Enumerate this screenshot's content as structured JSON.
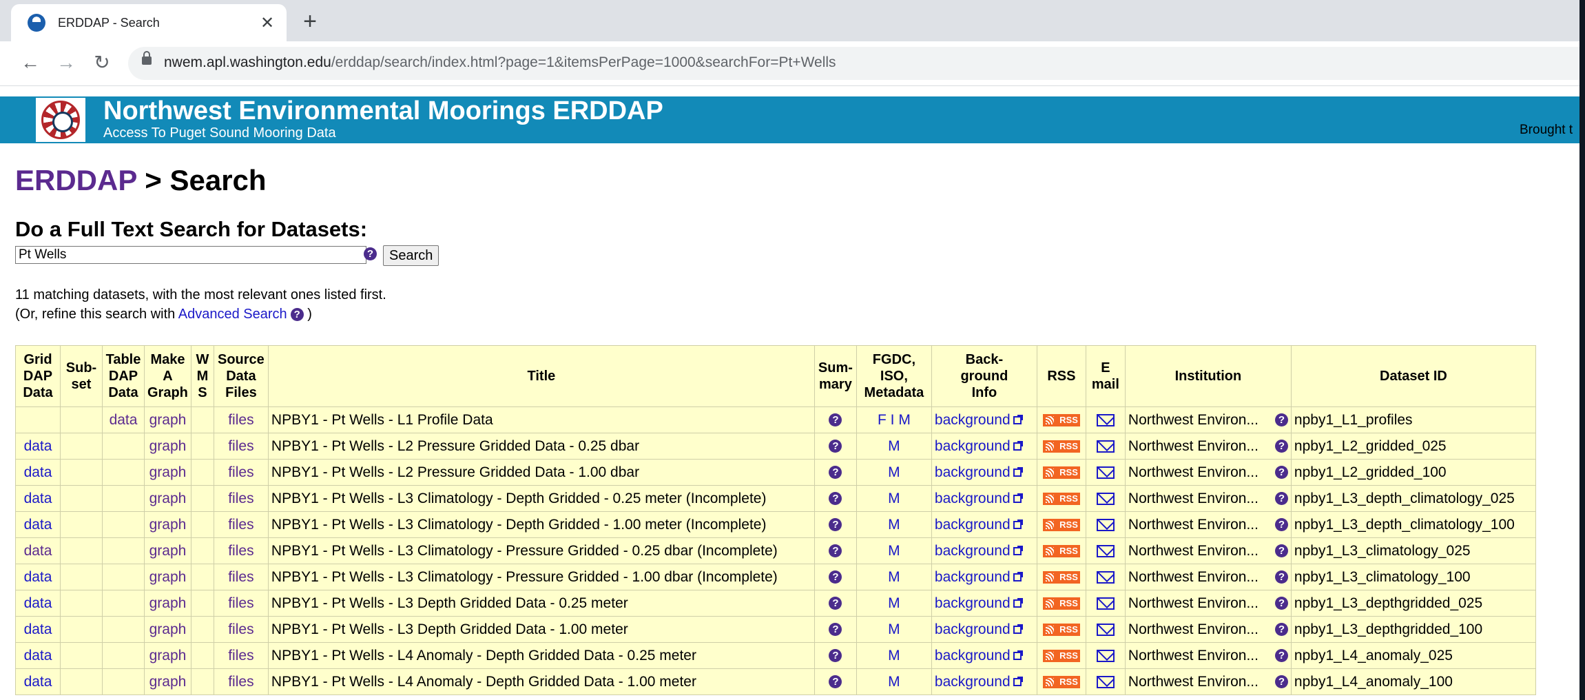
{
  "browser": {
    "tab_title": "ERDDAP - Search",
    "tab_close": "✕",
    "new_tab": "+",
    "url_host": "nwem.apl.washington.edu",
    "url_path": "/erddap/search/index.html?page=1&itemsPerPage=1000&searchFor=Pt+Wells",
    "back": "←",
    "forward": "→",
    "reload": "↻"
  },
  "banner": {
    "title": "Northwest Environmental Moorings ERDDAP",
    "subtitle": "Access To Puget Sound Mooring Data",
    "brought": "Brought t"
  },
  "breadcrumb": {
    "root": "ERDDAP",
    "separator": " > ",
    "current": "Search"
  },
  "search": {
    "heading": "Do a Full Text Search for Datasets:",
    "value": "Pt Wells",
    "button": "Search",
    "help": "?"
  },
  "results": {
    "count_text": "11 matching datasets, with the most relevant ones listed first.",
    "refine_prefix": "(Or, refine this search with ",
    "refine_link": "Advanced Search",
    "refine_suffix": " )"
  },
  "table": {
    "headers": {
      "griddap": [
        "Grid",
        "DAP",
        "Data"
      ],
      "subset": [
        "Sub-",
        "set"
      ],
      "tabledap": [
        "Table",
        "DAP",
        "Data"
      ],
      "graph": [
        "Make",
        "A",
        "Graph"
      ],
      "wms": [
        "W",
        "M",
        "S"
      ],
      "files": [
        "Source",
        "Data",
        "Files"
      ],
      "title": [
        "Title"
      ],
      "summary": [
        "Sum-",
        "mary"
      ],
      "metadata": [
        "FGDC,",
        "ISO,",
        "Metadata"
      ],
      "background": [
        "Back-",
        "ground",
        "Info"
      ],
      "rss": [
        "RSS"
      ],
      "email": [
        "E",
        "mail"
      ],
      "institution": [
        "Institution"
      ],
      "dataset_id": [
        "Dataset ID"
      ]
    },
    "rows": [
      {
        "griddap": "",
        "tabledap": "data",
        "graph": "graph",
        "files": "files",
        "title": "NPBY1 - Pt Wells - L1 Profile Data",
        "meta": "F  I  M",
        "background": "background",
        "rss": "RSS",
        "institution": "Northwest Environ...",
        "id": "npby1_L1_profiles"
      },
      {
        "griddap": "data",
        "tabledap": "",
        "graph": "graph",
        "files": "files",
        "title": "NPBY1 - Pt Wells - L2 Pressure Gridded Data - 0.25 dbar",
        "meta": "M",
        "background": "background",
        "rss": "RSS",
        "institution": "Northwest Environ...",
        "id": "npby1_L2_gridded_025"
      },
      {
        "griddap": "data",
        "tabledap": "",
        "graph": "graph",
        "files": "files",
        "title": "NPBY1 - Pt Wells - L2 Pressure Gridded Data - 1.00 dbar",
        "meta": "M",
        "background": "background",
        "rss": "RSS",
        "institution": "Northwest Environ...",
        "id": "npby1_L2_gridded_100"
      },
      {
        "griddap": "data",
        "tabledap": "",
        "graph": "graph",
        "files": "files",
        "title": "NPBY1 - Pt Wells - L3 Climatology - Depth Gridded - 0.25 meter (Incomplete)",
        "meta": "M",
        "background": "background",
        "rss": "RSS",
        "institution": "Northwest Environ...",
        "id": "npby1_L3_depth_climatology_025"
      },
      {
        "griddap": "data",
        "tabledap": "",
        "graph": "graph",
        "files": "files",
        "title": "NPBY1 - Pt Wells - L3 Climatology - Depth Gridded - 1.00 meter (Incomplete)",
        "meta": "M",
        "background": "background",
        "rss": "RSS",
        "institution": "Northwest Environ...",
        "id": "npby1_L3_depth_climatology_100"
      },
      {
        "griddap": "data",
        "tabledap": "",
        "graph": "graph",
        "files": "files",
        "title": "NPBY1 - Pt Wells - L3 Climatology - Pressure Gridded - 0.25 dbar (Incomplete)",
        "meta": "M",
        "background": "background",
        "rss": "RSS",
        "institution": "Northwest Environ...",
        "id": "npby1_L3_climatology_025"
      },
      {
        "griddap": "data",
        "tabledap": "",
        "graph": "graph",
        "files": "files",
        "title": "NPBY1 - Pt Wells - L3 Climatology - Pressure Gridded - 1.00 dbar (Incomplete)",
        "meta": "M",
        "background": "background",
        "rss": "RSS",
        "institution": "Northwest Environ...",
        "id": "npby1_L3_climatology_100"
      },
      {
        "griddap": "data",
        "tabledap": "",
        "graph": "graph",
        "files": "files",
        "title": "NPBY1 - Pt Wells - L3 Depth Gridded Data - 0.25 meter",
        "meta": "M",
        "background": "background",
        "rss": "RSS",
        "institution": "Northwest Environ...",
        "id": "npby1_L3_depthgridded_025"
      },
      {
        "griddap": "data",
        "tabledap": "",
        "graph": "graph",
        "files": "files",
        "title": "NPBY1 - Pt Wells - L3 Depth Gridded Data - 1.00 meter",
        "meta": "M",
        "background": "background",
        "rss": "RSS",
        "institution": "Northwest Environ...",
        "id": "npby1_L3_depthgridded_100"
      },
      {
        "griddap": "data",
        "tabledap": "",
        "graph": "graph",
        "files": "files",
        "title": "NPBY1 - Pt Wells - L4 Anomaly - Depth Gridded Data - 0.25 meter",
        "meta": "M",
        "background": "background",
        "rss": "RSS",
        "institution": "Northwest Environ...",
        "id": "npby1_L4_anomaly_025"
      },
      {
        "griddap": "data",
        "tabledap": "",
        "graph": "graph",
        "files": "files",
        "title": "NPBY1 - Pt Wells - L4 Anomaly - Depth Gridded Data - 1.00 meter",
        "meta": "M",
        "background": "background",
        "rss": "RSS",
        "institution": "Northwest Environ...",
        "id": "npby1_L4_anomaly_100"
      }
    ]
  },
  "colors": {
    "banner": "#128ab8",
    "table_bg": "#ffffcc",
    "link_blue": "#1a18c8",
    "link_visited": "#5b2a8f",
    "rss_orange": "#f26522"
  },
  "icons": {
    "help": "question-circle-icon",
    "rss": "rss-feed-icon",
    "email": "envelope-icon",
    "external": "external-link-icon",
    "lock": "lock-icon",
    "logo": "nwem-logo"
  }
}
